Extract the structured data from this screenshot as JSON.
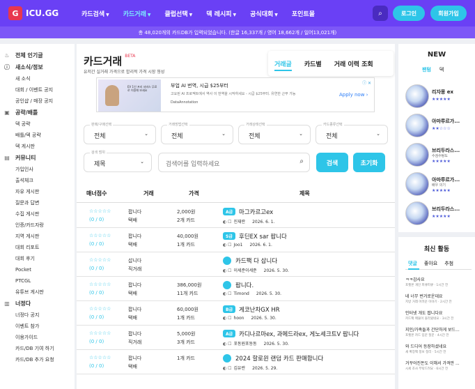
{
  "brand": {
    "logo_mark": "G",
    "name": "ICU.GG",
    "accent": "#6a40f5",
    "highlight": "#2ec5e8"
  },
  "nav": [
    {
      "label": "카드검색",
      "active": false
    },
    {
      "label": "카드거래",
      "active": true
    },
    {
      "label": "클럽선택",
      "active": false
    },
    {
      "label": "덱 레시피",
      "active": false
    },
    {
      "label": "공식대회",
      "active": false
    },
    {
      "label": "포인트몰",
      "active": false
    }
  ],
  "header": {
    "search_icon": "⌕",
    "login": "로그인",
    "signup": "회원가입"
  },
  "notice": "총 48,020개의 카드DB가 입력되었습니다. (한글 16,337개 / 영어 18,662개 / 일어13,021개)",
  "sidebar": {
    "top_item": {
      "icon": "♨",
      "label": "전체 인기글"
    },
    "groups": [
      {
        "icon": "ⓘ",
        "title": "새소식/정보",
        "items": [
          "새 소식",
          "대회 / 이벤트 공지",
          "공인샵 / 매장 공지"
        ]
      },
      {
        "icon": "▣",
        "title": "공략/배틀",
        "items": [
          "덱 공략",
          "배틀/덱 공략",
          "덱 게시판"
        ]
      },
      {
        "icon": "▤",
        "title": "커뮤니티",
        "items": [
          "가입인사",
          "출석체크",
          "자유 게시판",
          "질문과 답변",
          "수집 게시판",
          "인증/카드자랑",
          "지역 게시판",
          "대회 리포트",
          "대회 후기",
          "Pocket",
          "PTCGL",
          "유튜브 게시판"
        ]
      },
      {
        "icon": "▥",
        "title": "너정다",
        "items": [
          "너정다 공지",
          "이벤트 참가",
          "이용가이드",
          "카드/DB 기여 하기",
          "카드/DB 추가 요청"
        ]
      }
    ]
  },
  "main": {
    "title": "카드거래",
    "beta": "BETA",
    "subtitle": "유저간 실거래 가격으로 합리적 가격 시장 형성",
    "tabs": [
      "거래글",
      "카드별",
      "거래 이력 조회"
    ],
    "ad": {
      "image_text": "EV 1인 프리 서비스 무료로 이용해 보세요",
      "title": "부업 AI 번역, 시급 $25부터",
      "desc": "고요된 AI 프로젝트에서 역사 이 번역을 시작하세요 - 시급 $25부터. 유연한 근무 가능",
      "source": "DataAnnotation",
      "apply": "Apply now",
      "arrow": "›",
      "info": "ⓘ ✕"
    },
    "filters": [
      {
        "label": "판매/구매선택",
        "value": "전체",
        "chevron": "⌄"
      },
      {
        "label": "거래방법선택",
        "value": "전체",
        "chevron": "⌄"
      },
      {
        "label": "거래상태선택",
        "value": "전체",
        "chevron": "⌄"
      },
      {
        "label": "카드종류선택",
        "value": "전체",
        "chevron": "⌄"
      }
    ],
    "search_type": {
      "label": "검색 범위",
      "value": "제목",
      "chevron": "⌄"
    },
    "search_placeholder": "검색어를 입력하세요",
    "search_icon": "⌕",
    "search_button": "검색",
    "reset_button": "초기화",
    "table_headers": [
      "매너점수",
      "거래",
      "가격",
      "제목"
    ],
    "rows": [
      {
        "stars": "☆☆☆☆☆",
        "rating": "(0 / 0)",
        "type": "팝니다",
        "method": "택배",
        "price": "2,000원",
        "count": "2개 카드",
        "badge": "A급",
        "title": "마그카르고ex",
        "icons": "◐ ☐",
        "author": "진재란",
        "date": "2026. 6. 1."
      },
      {
        "stars": "☆☆☆☆☆",
        "rating": "(0 / 0)",
        "type": "팝니다",
        "method": "택배",
        "price": "40,000원",
        "count": "1개 카드",
        "badge": "S급",
        "title": "후딘EX sar 팝니다",
        "icons": "◐ ☐",
        "author": "Joo1",
        "date": "2026. 6. 1."
      },
      {
        "stars": "☆☆☆☆☆",
        "rating": "(0 / 0)",
        "type": "삽니다",
        "method": "직거래",
        "price": "",
        "count": "",
        "badge": "",
        "title": "카드팩 다 삽니다",
        "icons": "◐ ☐",
        "author": "이세준이세준",
        "date": "2026. 5. 30."
      },
      {
        "stars": "☆☆☆☆☆",
        "rating": "(0 / 0)",
        "type": "팝니다",
        "method": "택배",
        "price": "386,000원",
        "count": "11개 카드",
        "badge": "",
        "title": "팝니다.",
        "icons": "◐ ☐",
        "author": "Timond",
        "date": "2026. 5. 30."
      },
      {
        "stars": "☆☆☆☆☆",
        "rating": "(0 / 0)",
        "type": "팝니다",
        "method": "택배",
        "price": "60,000원",
        "count": "1개 카드",
        "badge": "B급",
        "title": "게코난차GX HR",
        "icons": "◐ ☐",
        "author": "hoon",
        "date": "2026. 5. 30."
      },
      {
        "stars": "☆☆☆☆☆",
        "rating": "(0 / 0)",
        "type": "팝니다",
        "method": "직거래",
        "price": "5,000원",
        "count": "3개 카드",
        "badge": "A급",
        "title": "카디나르마ex, 과메드라ex, 게노세크트V 팝니다",
        "icons": "◐ ☐",
        "author": "포동원포동동",
        "date": "2026. 5. 30."
      },
      {
        "stars": "☆☆☆☆☆",
        "rating": "(0 / 0)",
        "type": "팝니다",
        "method": "택배",
        "price": "",
        "count": "1개 카드",
        "badge": "",
        "title": "2024 할로윈 랜덤 카드 판매합니다",
        "icons": "◐ ☐",
        "author": "김유란",
        "date": "2026. 5. 29."
      }
    ]
  },
  "new_panel": {
    "title": "NEW",
    "tabs": [
      "팬텀",
      "덱"
    ],
    "cards": [
      {
        "name": "리자몽 ex",
        "stars": "★★★★★"
      },
      {
        "name": "아마루르가...",
        "stars": "★★☆☆☆"
      },
      {
        "name": "브리두라스...",
        "sub": "수검수탕도",
        "stars": "★★★★★"
      },
      {
        "name": "아마루르가...",
        "sub": "배우 의기",
        "stars": "★★★★★"
      },
      {
        "name": "브리두라스...",
        "stars": "★★★★★"
      }
    ]
  },
  "activity": {
    "title": "최신 활동",
    "tabs": [
      "댓글",
      "좋아요",
      "추첨"
    ],
    "items": [
      {
        "text": "ㅋㅋ감사요",
        "sub": "포켓몬 개인 피큐피큐 · 1시간 전"
      },
      {
        "text": "네 너무 번거로운데요",
        "sub": "지방 거래 어려운 이야기 · 2시간 전"
      },
      {
        "text": "인터넷 개도 팝니다요",
        "sub": "카드팩 매물이 올라왔네요 · 3시간 전"
      },
      {
        "text": "지인/가족들과 간단하게 보드...",
        "sub": "포켓몬 카드 입문 질문 · 4시간 전"
      },
      {
        "text": "와 드디어 등장하셨네요",
        "sub": "새 확장팩 정보 정리 · 5시간 전"
      },
      {
        "text": "거꾸어진돈도 이해서 가격만 ...",
        "sub": "시세 조사 부탁드려요 · 6시간 전"
      }
    ]
  }
}
